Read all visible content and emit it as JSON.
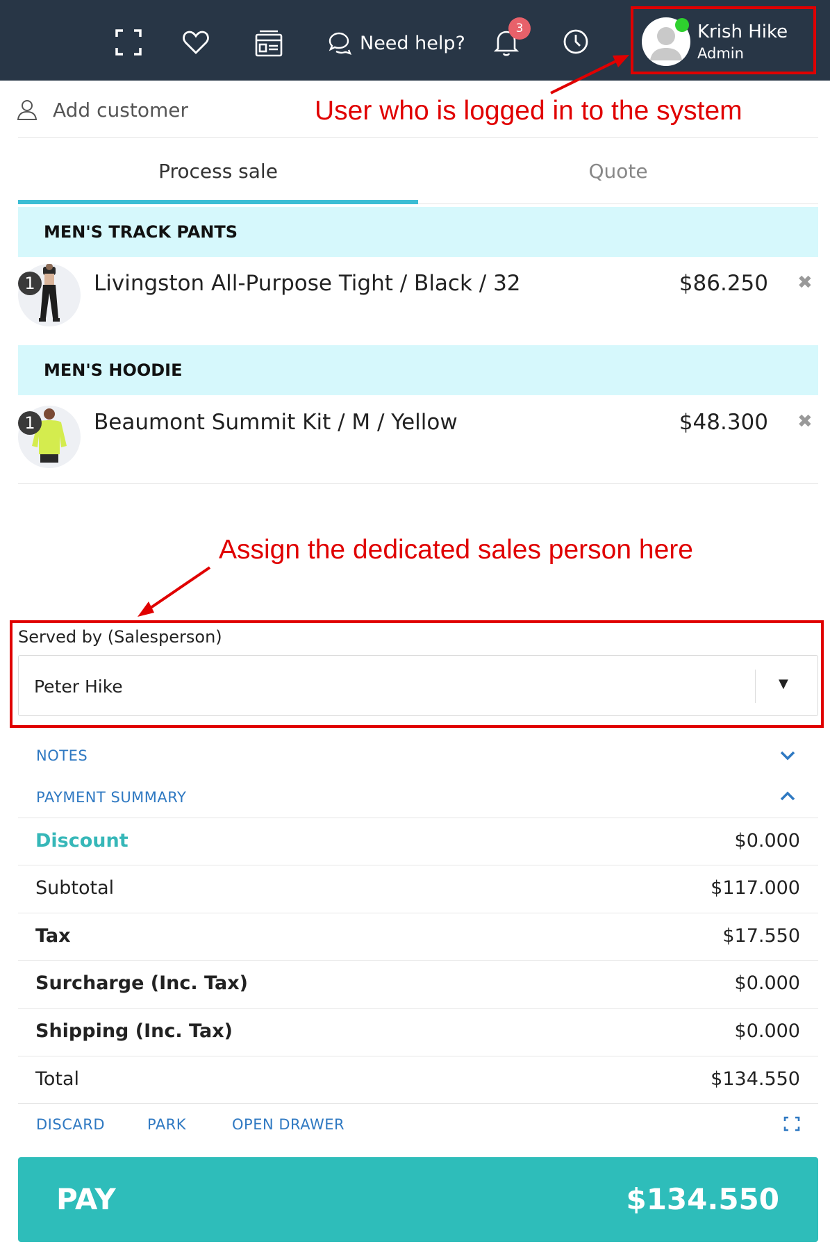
{
  "header": {
    "help_label": "Need help?",
    "notification_count": "3",
    "user": {
      "name": "Krish Hike",
      "role": "Admin"
    }
  },
  "customer": {
    "add_label": "Add customer"
  },
  "annotations": {
    "logged_in": "User who is logged in to the system",
    "salesperson": "Assign the dedicated sales person here"
  },
  "tabs": [
    {
      "label": "Process sale",
      "active": true
    },
    {
      "label": "Quote",
      "active": false
    }
  ],
  "cart": {
    "groups": [
      {
        "category": "MEN'S TRACK PANTS",
        "item": {
          "qty": "1",
          "name": "Livingston All-Purpose Tight / Black / 32",
          "price": "$86.250"
        }
      },
      {
        "category": "MEN'S HOODIE",
        "item": {
          "qty": "1",
          "name": "Beaumont Summit Kit / M / Yellow",
          "price": "$48.300"
        }
      }
    ]
  },
  "salesperson": {
    "label": "Served by (Salesperson)",
    "selected": "Peter Hike"
  },
  "sections": {
    "notes": "NOTES",
    "payment_summary": "PAYMENT SUMMARY"
  },
  "summary": {
    "discount": {
      "label": "Discount",
      "value": "$0.000"
    },
    "subtotal": {
      "label": "Subtotal",
      "value": "$117.000"
    },
    "tax": {
      "label": "Tax",
      "value": "$17.550"
    },
    "surcharge": {
      "label": "Surcharge (Inc. Tax)",
      "value": "$0.000"
    },
    "shipping": {
      "label": "Shipping (Inc. Tax)",
      "value": "$0.000"
    },
    "total": {
      "label": "Total",
      "value": "$134.550"
    }
  },
  "actions": {
    "discard": "DISCARD",
    "park": "PARK",
    "open_drawer": "OPEN DRAWER"
  },
  "pay": {
    "label": "PAY",
    "amount": "$134.550"
  },
  "colors": {
    "header_bg": "#283646",
    "accent_teal": "#2ebdba",
    "tab_underline": "#3bbdd4",
    "category_bg": "#d6f8fc",
    "link_blue": "#2f79c2",
    "annotation_red": "#e00000",
    "badge_red": "#e8616a",
    "online_green": "#2ed12e"
  },
  "icons": [
    "fullscreen-icon",
    "heart-icon",
    "register-icon",
    "chat-icon",
    "bell-icon",
    "clock-icon",
    "user-outline-icon",
    "close-icon",
    "chevron-down-icon",
    "chevron-up-icon"
  ]
}
